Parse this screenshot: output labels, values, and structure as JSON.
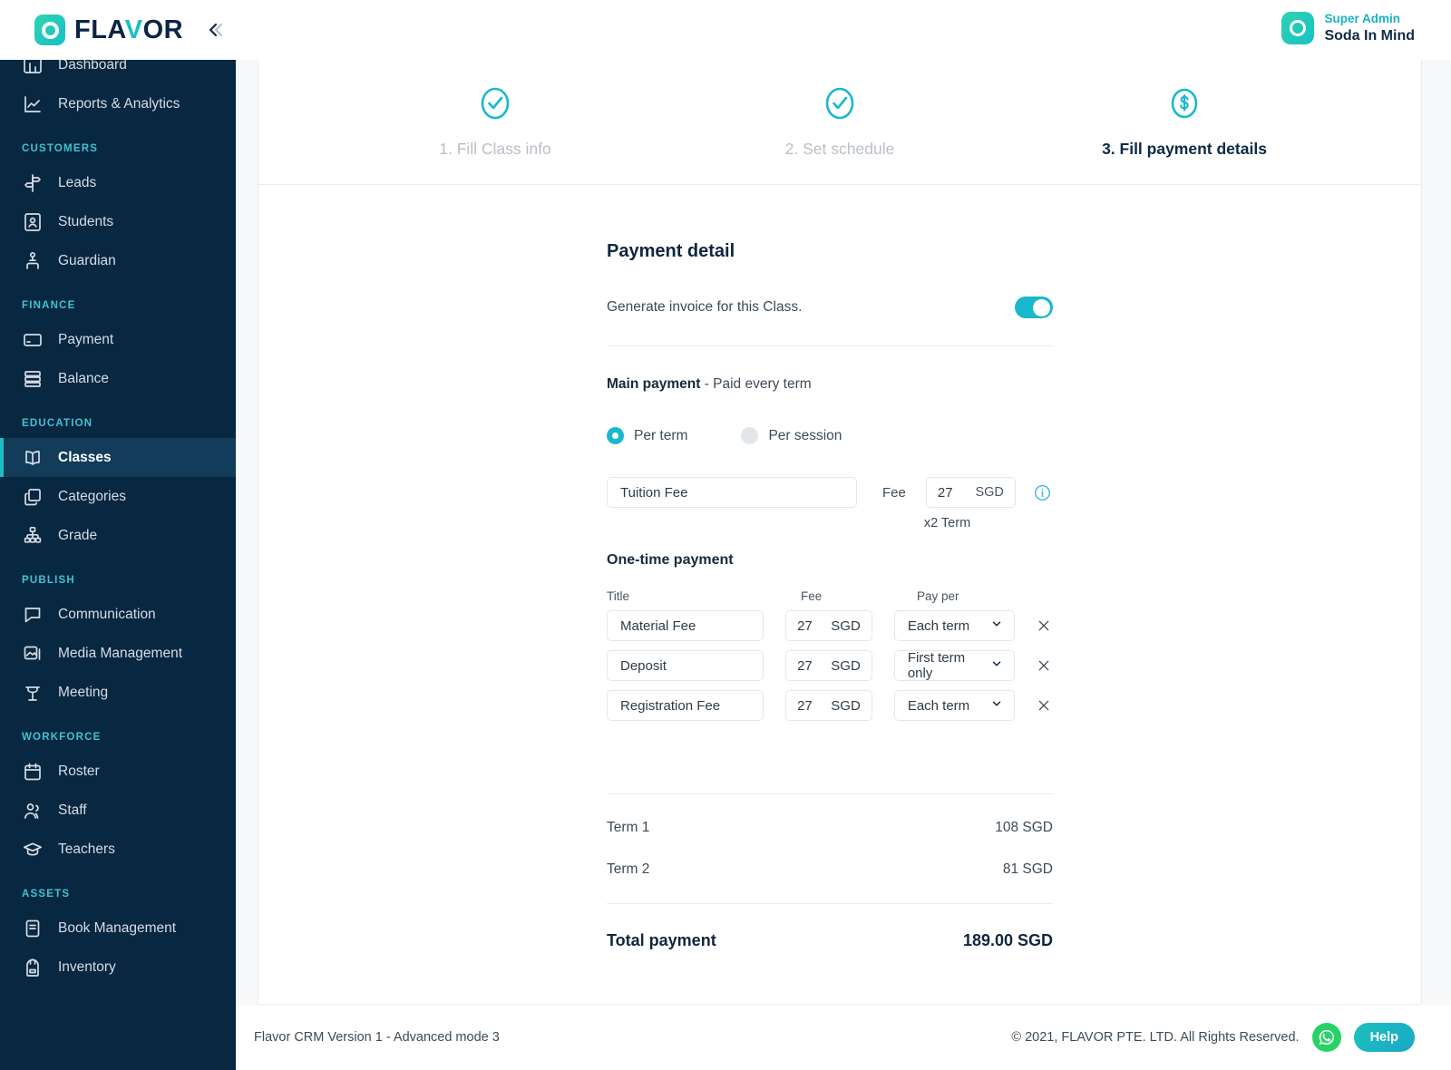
{
  "brand": {
    "name_part1": "FLA",
    "name_v": "V",
    "name_part2": "OR",
    "logo_icon": "flavor-circle-logo",
    "collapse_icon": "chevron-double-left-icon"
  },
  "user": {
    "role": "Super Admin",
    "name": "Soda In Mind",
    "avatar_icon": "user-avatar-circle"
  },
  "sidebar": {
    "groups": [
      {
        "label": null,
        "items": [
          {
            "label": "Dashboard",
            "icon": "dashboard-icon",
            "active": false
          },
          {
            "label": "Reports & Analytics",
            "icon": "analytics-icon",
            "active": false
          }
        ]
      },
      {
        "label": "CUSTOMERS",
        "items": [
          {
            "label": "Leads",
            "icon": "signpost-icon",
            "active": false
          },
          {
            "label": "Students",
            "icon": "student-card-icon",
            "active": false
          },
          {
            "label": "Guardian",
            "icon": "guardian-icon",
            "active": false
          }
        ]
      },
      {
        "label": "FINANCE",
        "items": [
          {
            "label": "Payment",
            "icon": "credit-card-icon",
            "active": false
          },
          {
            "label": "Balance",
            "icon": "balance-sheet-icon",
            "active": false
          }
        ]
      },
      {
        "label": "EDUCATION",
        "items": [
          {
            "label": "Classes",
            "icon": "book-open-icon",
            "active": true
          },
          {
            "label": "Categories",
            "icon": "layers-icon",
            "active": false
          },
          {
            "label": "Grade",
            "icon": "hierarchy-icon",
            "active": false
          }
        ]
      },
      {
        "label": "PUBLISH",
        "items": [
          {
            "label": "Communication",
            "icon": "chat-bubble-icon",
            "active": false
          },
          {
            "label": "Media Management",
            "icon": "image-stack-icon",
            "active": false
          },
          {
            "label": "Meeting",
            "icon": "podium-icon",
            "active": false
          }
        ]
      },
      {
        "label": "WORKFORCE",
        "items": [
          {
            "label": "Roster",
            "icon": "calendar-icon",
            "active": false
          },
          {
            "label": "Staff",
            "icon": "people-icon",
            "active": false
          },
          {
            "label": "Teachers",
            "icon": "graduation-cap-icon",
            "active": false
          }
        ]
      },
      {
        "label": "ASSETS",
        "items": [
          {
            "label": "Book Management",
            "icon": "book-icon",
            "active": false
          },
          {
            "label": "Inventory",
            "icon": "backpack-icon",
            "active": false
          }
        ]
      }
    ]
  },
  "steps": [
    {
      "label": "1. Fill Class info",
      "icon": "check-circle-icon",
      "state": "done"
    },
    {
      "label": "2. Set schedule",
      "icon": "check-circle-icon",
      "state": "done"
    },
    {
      "label": "3. Fill payment details",
      "icon": "dollar-circle-icon",
      "state": "current"
    }
  ],
  "payment": {
    "section_title": "Payment detail",
    "generate_invoice_label": "Generate invoice for this Class.",
    "generate_invoice_on": true,
    "main_payment_bold": "Main payment",
    "main_payment_rest": " - Paid every term",
    "frequency_options": [
      {
        "label": "Per term",
        "selected": true
      },
      {
        "label": "Per session",
        "selected": false
      }
    ],
    "main_row": {
      "title": "Tuition Fee",
      "fee_label": "Fee",
      "amount": "27",
      "currency": "SGD",
      "multiplier_note": "x2 Term",
      "info_icon": "info-circle-icon"
    },
    "onetime": {
      "title": "One-time payment",
      "columns": [
        "Title",
        "Fee",
        "Pay per"
      ],
      "rows": [
        {
          "title": "Material Fee",
          "amount": "27",
          "currency": "SGD",
          "pay_per": "Each term"
        },
        {
          "title": "Deposit",
          "amount": "27",
          "currency": "SGD",
          "pay_per": "First term only"
        },
        {
          "title": "Registration Fee",
          "amount": "27",
          "currency": "SGD",
          "pay_per": "Each term"
        }
      ],
      "remove_icon": "close-x-icon",
      "dropdown_icon": "chevron-down-icon"
    },
    "totals": [
      {
        "label": "Term 1",
        "value": "108 SGD"
      },
      {
        "label": "Term 2",
        "value": "81 SGD"
      }
    ],
    "grand_total": {
      "label": "Total payment",
      "value": "189.00 SGD"
    }
  },
  "footer": {
    "version": "Flavor CRM Version 1 - Advanced mode 3",
    "copyright": "© 2021, FLAVOR PTE. LTD. All Rights Reserved.",
    "whatsapp_icon": "whatsapp-icon",
    "help_label": "Help"
  },
  "colors": {
    "accent": "#19b8cc",
    "sidebar_bg": "#082740",
    "sidebar_active_bg": "#123c5a",
    "dark_text": "#10263f",
    "whatsapp_green": "#25d366"
  }
}
